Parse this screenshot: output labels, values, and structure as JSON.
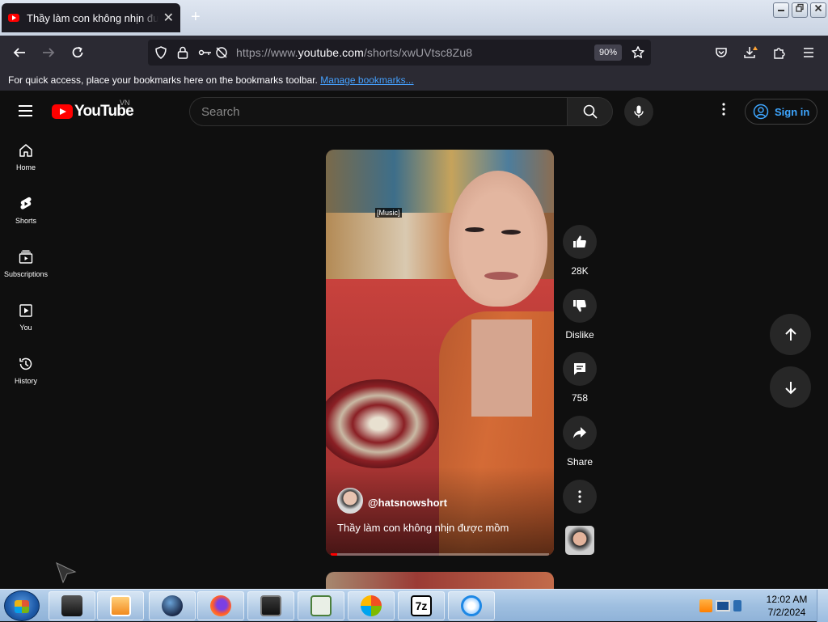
{
  "browser": {
    "tab_title": "Thầy làm con không nhịn được",
    "tab_close": "✕",
    "new_tab": "+",
    "url_prefix": "https://www.",
    "url_host": "youtube.com",
    "url_path": "/shorts/xwUVtsc8Zu8",
    "zoom": "90%",
    "bookmarks_message": "For quick access, place your bookmarks here on the bookmarks toolbar.",
    "manage_bookmarks": "Manage bookmarks..."
  },
  "youtube": {
    "logo_text": "YouTube",
    "region": "VN",
    "search_placeholder": "Search",
    "sign_in": "Sign in",
    "sidebar": [
      {
        "label": "Home",
        "icon": "home-icon"
      },
      {
        "label": "Shorts",
        "icon": "shorts-icon"
      },
      {
        "label": "Subscriptions",
        "icon": "subscriptions-icon"
      },
      {
        "label": "You",
        "icon": "you-icon"
      },
      {
        "label": "History",
        "icon": "history-icon"
      }
    ],
    "short": {
      "caption": "[Music]",
      "channel": "@hatsnowshort",
      "title": "Thầy làm con không nhịn được mồm",
      "progress": 0.03
    },
    "actions": {
      "likes": "28K",
      "dislike": "Dislike",
      "comments": "758",
      "share": "Share"
    }
  },
  "taskbar": {
    "time": "12:02 AM",
    "date": "7/2/2024"
  }
}
